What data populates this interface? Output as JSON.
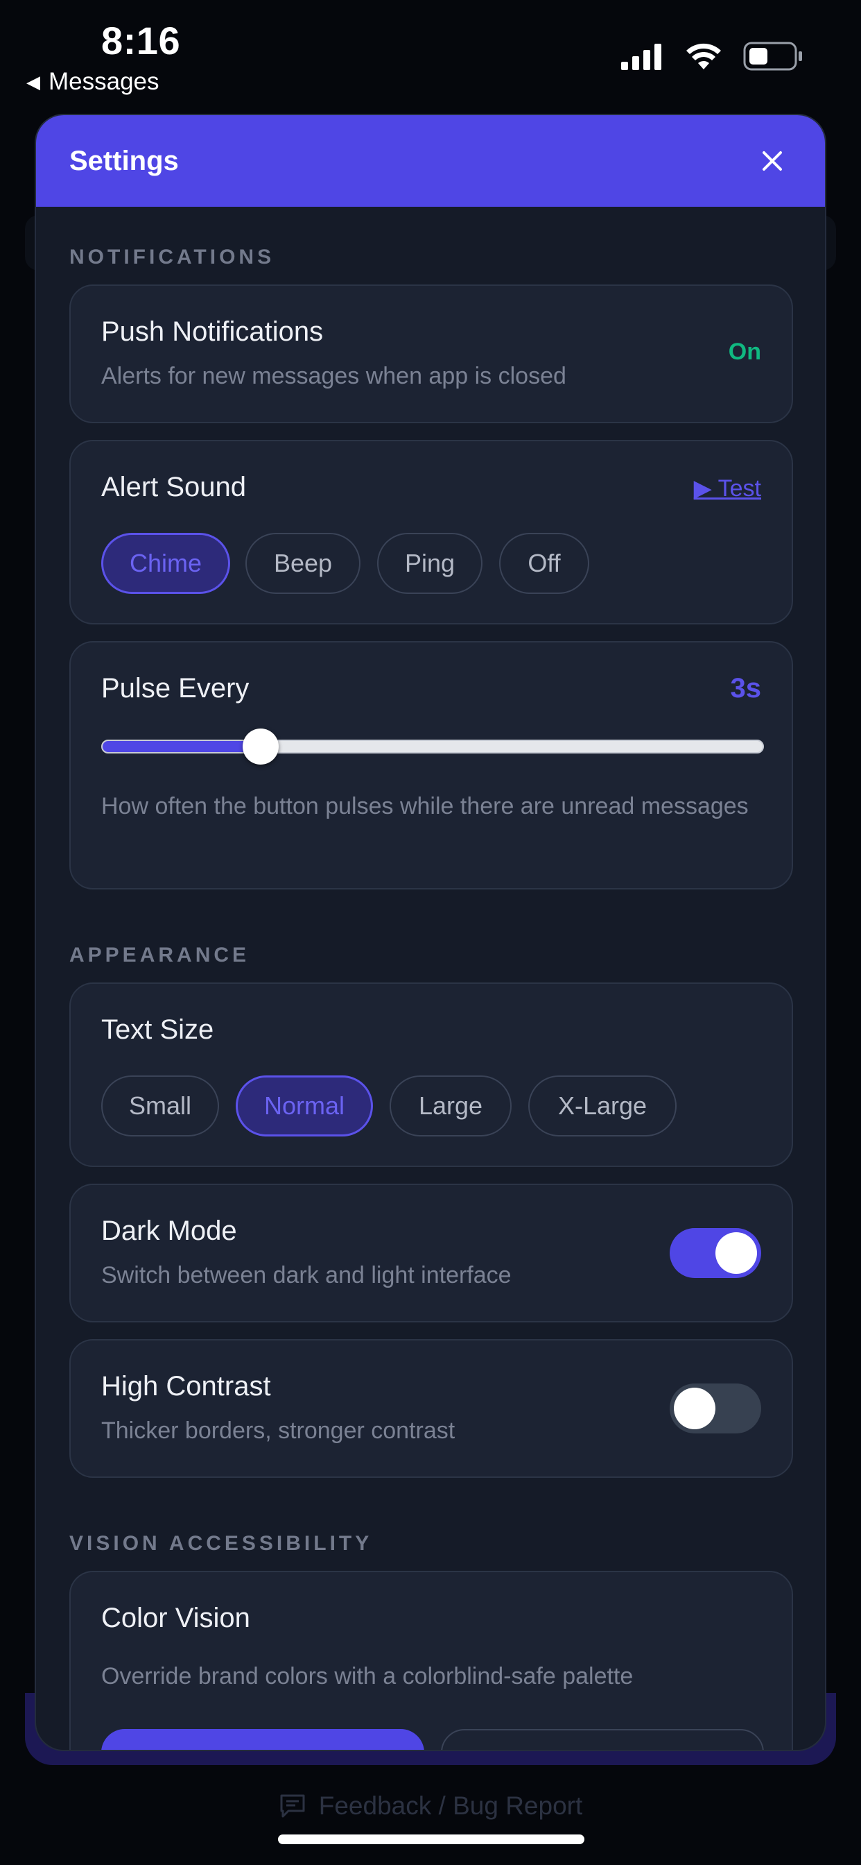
{
  "status_bar": {
    "time": "8:16",
    "back_label": "Messages"
  },
  "footer": {
    "feedback_label": "Feedback / Bug Report"
  },
  "modal": {
    "title": "Settings",
    "close_icon": "close-icon"
  },
  "notifications": {
    "section_label": "NOTIFICATIONS",
    "push": {
      "title": "Push Notifications",
      "subtitle": "Alerts for new messages when app is closed",
      "status": "On"
    },
    "alert_sound": {
      "title": "Alert Sound",
      "test_label": "▶ Test",
      "options": [
        "Chime",
        "Beep",
        "Ping",
        "Off"
      ],
      "selected": "Chime"
    },
    "pulse": {
      "title": "Pulse Every",
      "value_label": "3s",
      "slider_fraction": 0.24,
      "description": "How often the button pulses while there are unread messages"
    }
  },
  "appearance": {
    "section_label": "APPEARANCE",
    "text_size": {
      "title": "Text Size",
      "options": [
        "Small",
        "Normal",
        "Large",
        "X-Large"
      ],
      "selected": "Normal"
    },
    "dark_mode": {
      "title": "Dark Mode",
      "subtitle": "Switch between dark and light interface",
      "on": true
    },
    "high_contrast": {
      "title": "High Contrast",
      "subtitle": "Thicker borders, stronger contrast",
      "on": false
    }
  },
  "vision": {
    "section_label": "VISION ACCESSIBILITY",
    "color_vision": {
      "title": "Color Vision",
      "subtitle": "Override brand colors with a colorblind-safe palette"
    }
  },
  "colors": {
    "accent": "#4f46e5",
    "success": "#10b981",
    "card_bg": "#1c2333",
    "modal_bg": "#151b28"
  }
}
